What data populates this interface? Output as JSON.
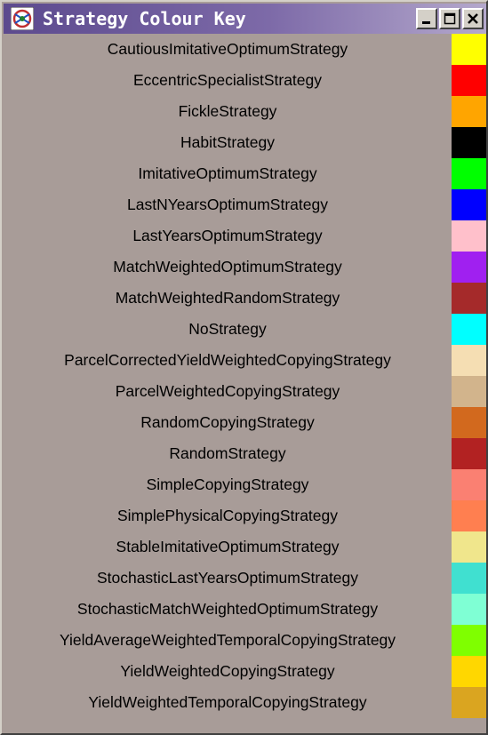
{
  "window": {
    "title": "Strategy Colour Key"
  },
  "strategies": [
    {
      "label": "CautiousImitativeOptimumStrategy",
      "color": "#ffff00"
    },
    {
      "label": "EccentricSpecialistStrategy",
      "color": "#ff0000"
    },
    {
      "label": "FickleStrategy",
      "color": "#ffa500"
    },
    {
      "label": "HabitStrategy",
      "color": "#000000"
    },
    {
      "label": "ImitativeOptimumStrategy",
      "color": "#00ff00"
    },
    {
      "label": "LastNYearsOptimumStrategy",
      "color": "#0000ff"
    },
    {
      "label": "LastYearsOptimumStrategy",
      "color": "#ffc0cb"
    },
    {
      "label": "MatchWeightedOptimumStrategy",
      "color": "#a020f0"
    },
    {
      "label": "MatchWeightedRandomStrategy",
      "color": "#a52a2a"
    },
    {
      "label": "NoStrategy",
      "color": "#00ffff"
    },
    {
      "label": "ParcelCorrectedYieldWeightedCopyingStrategy",
      "color": "#f5deb3"
    },
    {
      "label": "ParcelWeightedCopyingStrategy",
      "color": "#d2b48c"
    },
    {
      "label": "RandomCopyingStrategy",
      "color": "#d2691e"
    },
    {
      "label": "RandomStrategy",
      "color": "#b22222"
    },
    {
      "label": "SimpleCopyingStrategy",
      "color": "#fa8072"
    },
    {
      "label": "SimplePhysicalCopyingStrategy",
      "color": "#ff7f50"
    },
    {
      "label": "StableImitativeOptimumStrategy",
      "color": "#f0e68c"
    },
    {
      "label": "StochasticLastYearsOptimumStrategy",
      "color": "#40e0d0"
    },
    {
      "label": "StochasticMatchWeightedOptimumStrategy",
      "color": "#7fffd4"
    },
    {
      "label": "YieldAverageWeightedTemporalCopyingStrategy",
      "color": "#7fff00"
    },
    {
      "label": "YieldWeightedCopyingStrategy",
      "color": "#ffd700"
    },
    {
      "label": "YieldWeightedTemporalCopyingStrategy",
      "color": "#daa520"
    }
  ]
}
